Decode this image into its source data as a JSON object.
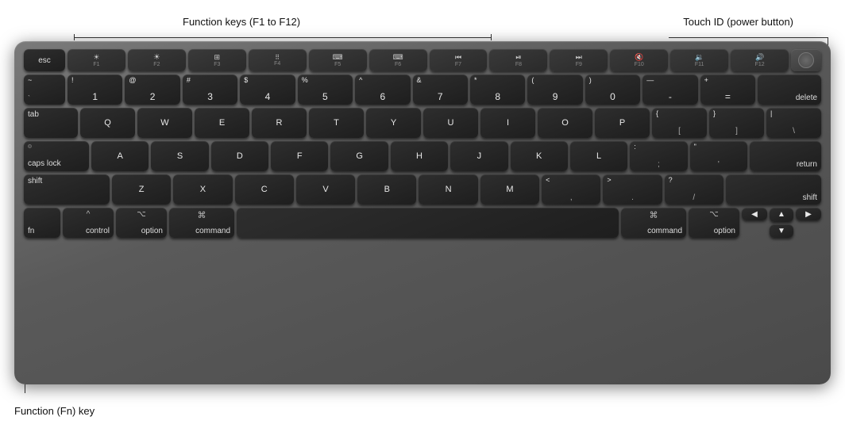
{
  "annotations": {
    "fn_keys_label": "Function keys (F1 to F12)",
    "touchid_label": "Touch ID (power button)",
    "fn_key_label": "Function (Fn) key"
  },
  "keyboard": {
    "rows": [
      {
        "id": "fn-row",
        "keys": [
          {
            "id": "esc",
            "label": "esc",
            "wide": true
          },
          {
            "id": "f1",
            "top": "☀",
            "num": "F1",
            "icon": "brightness-down"
          },
          {
            "id": "f2",
            "top": "☀☀",
            "num": "F2",
            "icon": "brightness-up"
          },
          {
            "id": "f3",
            "top": "⊞",
            "num": "F3",
            "icon": "mission-control"
          },
          {
            "id": "f4",
            "top": "⊞⊞",
            "num": "F4",
            "icon": "launchpad"
          },
          {
            "id": "f5",
            "top": "◌◌",
            "num": "F5",
            "icon": "keyboard-backlight-down"
          },
          {
            "id": "f6",
            "top": "◌◌◌",
            "num": "F6",
            "icon": "keyboard-backlight-up"
          },
          {
            "id": "f7",
            "top": "◁◁",
            "num": "F7",
            "icon": "rewind"
          },
          {
            "id": "f8",
            "top": "▶‖",
            "num": "F8",
            "icon": "play-pause"
          },
          {
            "id": "f9",
            "top": "▷▷",
            "num": "F9",
            "icon": "fast-forward"
          },
          {
            "id": "f10",
            "top": "◁",
            "num": "F10",
            "icon": "mute"
          },
          {
            "id": "f11",
            "top": "◁)",
            "num": "F11",
            "icon": "volume-down"
          },
          {
            "id": "f12",
            "top": "◁))",
            "num": "F12",
            "icon": "volume-up"
          },
          {
            "id": "touchid",
            "label": "",
            "type": "touchid"
          }
        ]
      }
    ]
  }
}
